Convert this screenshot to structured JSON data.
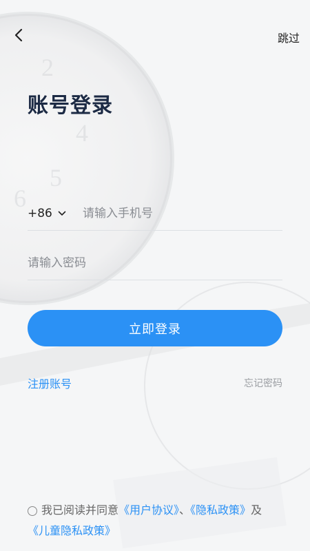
{
  "nav": {
    "back_icon": "chevron-left-icon",
    "skip_label": "跳过"
  },
  "title": "账号登录",
  "phone": {
    "country_code": "+86",
    "dropdown_icon": "chevron-down-icon",
    "placeholder": "请输入手机号",
    "value": ""
  },
  "password": {
    "placeholder": "请输入密码",
    "value": ""
  },
  "login_button_label": "立即登录",
  "register_label": "注册账号",
  "forgot_label": "忘记密码",
  "agreement": {
    "checked": false,
    "prefix": "我已阅读并同意",
    "user_agreement": "《用户协议》",
    "separator": "、",
    "privacy_policy": "《隐私政策》",
    "and": "及",
    "child_privacy_policy": "《儿童隐私政策》"
  },
  "colors": {
    "accent": "#2b91f5",
    "title": "#1c2a44"
  }
}
